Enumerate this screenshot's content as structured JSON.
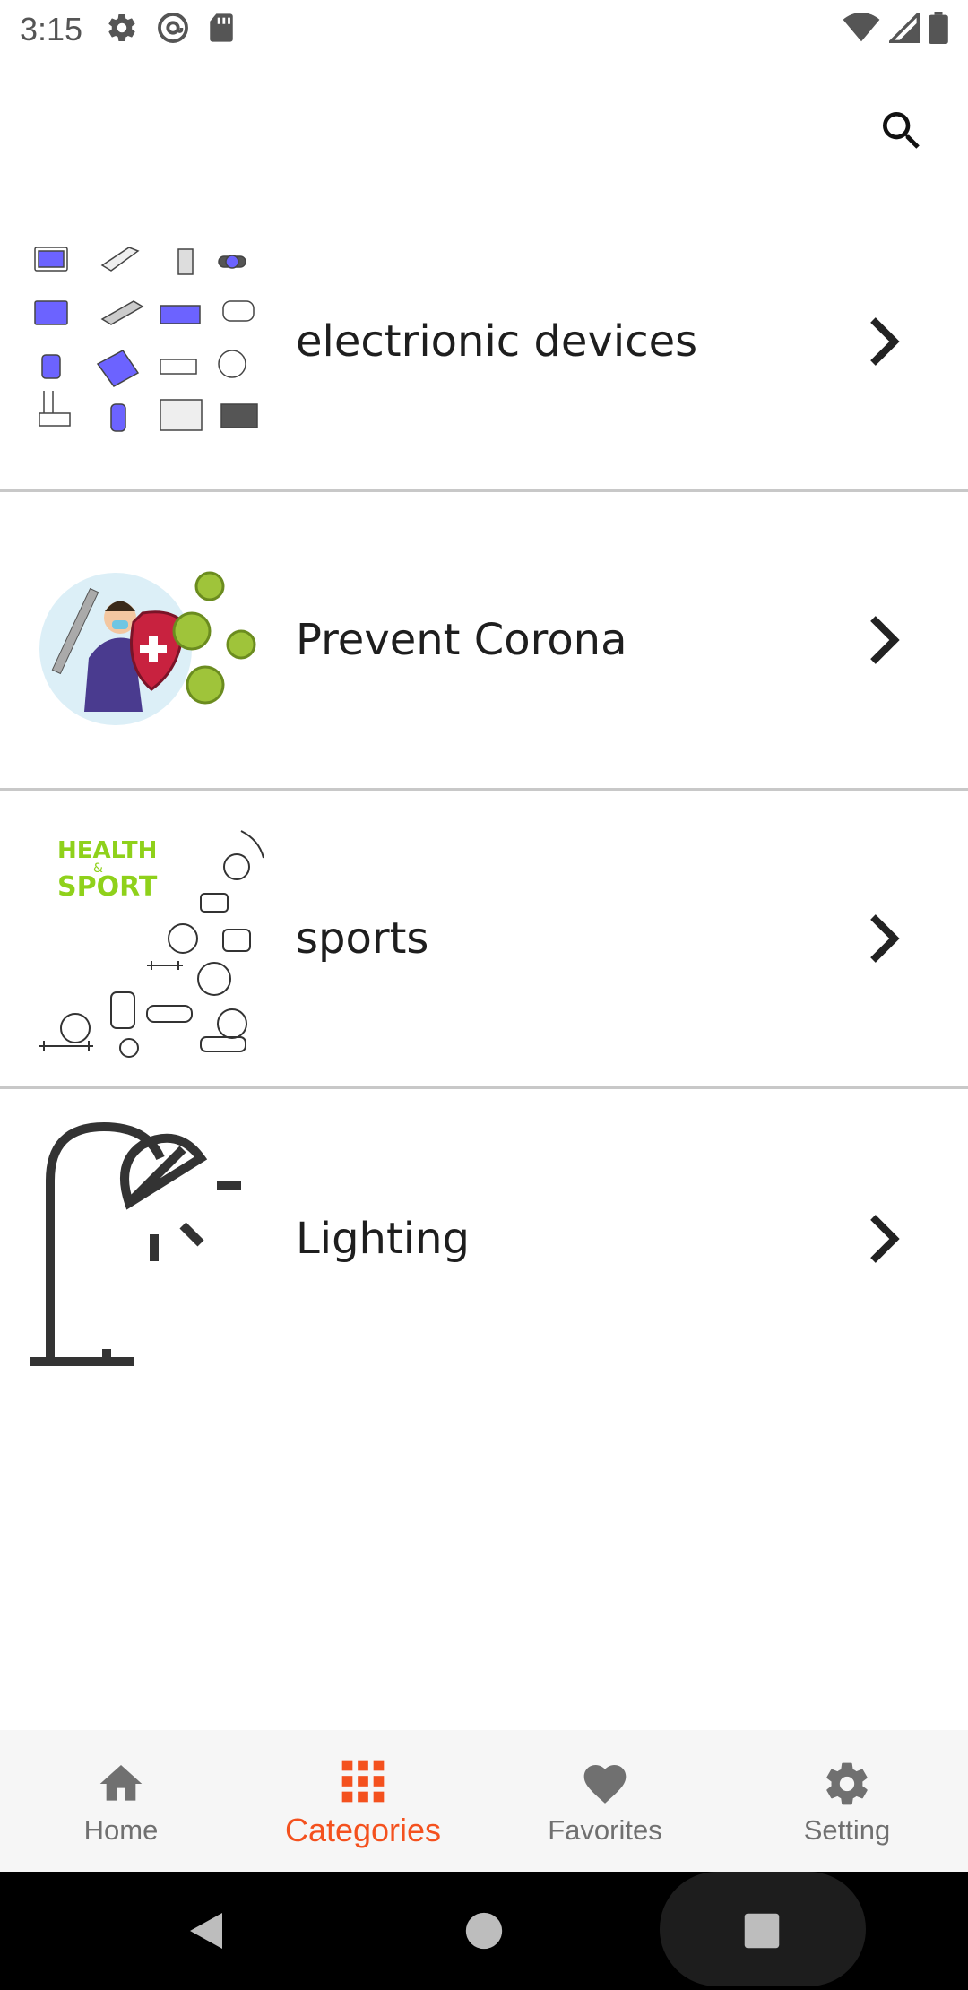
{
  "status_bar": {
    "time": "3:15"
  },
  "top_bar": {
    "search_icon": "search-icon"
  },
  "categories": [
    {
      "label": "electrionic devices",
      "thumbnail": "electronic-devices-image"
    },
    {
      "label": "Prevent Corona",
      "thumbnail": "prevent-corona-image"
    },
    {
      "label": "sports",
      "thumbnail": "health-sport-image",
      "thumbnail_text": [
        "HEALTH",
        "&",
        "SPORT"
      ]
    },
    {
      "label": "Lighting",
      "thumbnail": "lamp-image"
    }
  ],
  "bottom_nav": {
    "items": [
      {
        "label": "Home",
        "icon": "home-icon"
      },
      {
        "label": "Categories",
        "icon": "grid-icon",
        "active": true
      },
      {
        "label": "Favorites",
        "icon": "heart-icon"
      },
      {
        "label": "Setting",
        "icon": "gear-icon"
      }
    ]
  },
  "colors": {
    "accent": "#f4511e",
    "inactive": "#707070",
    "divider": "#c8c8c8"
  }
}
